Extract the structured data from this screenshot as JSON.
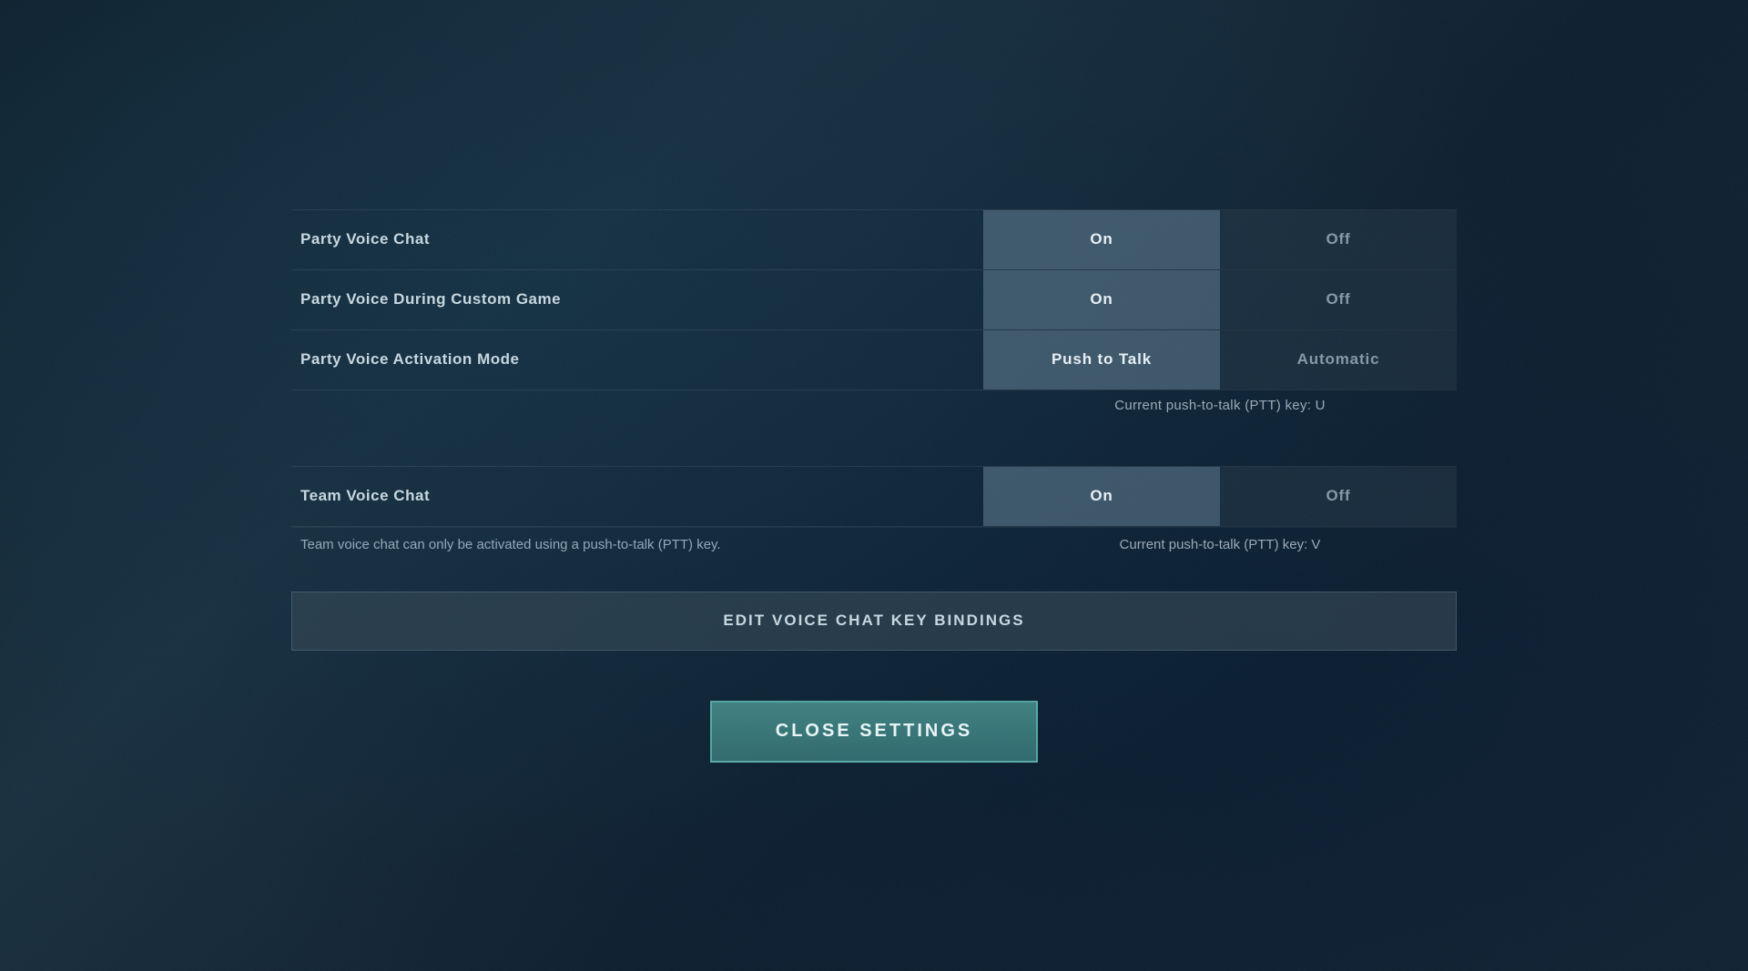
{
  "settings": {
    "party_voice_chat": {
      "label": "Party Voice Chat",
      "options": [
        "On",
        "Off"
      ],
      "selected": "On"
    },
    "party_voice_during_custom": {
      "label": "Party Voice During Custom Game",
      "options": [
        "On",
        "Off"
      ],
      "selected": "On"
    },
    "party_voice_activation": {
      "label": "Party Voice Activation Mode",
      "options": [
        "Push to Talk",
        "Automatic"
      ],
      "selected": "Push to Talk"
    },
    "party_ptt_key": {
      "label": "Current push-to-talk (PTT) key: U"
    },
    "team_voice_chat": {
      "label": "Team Voice Chat",
      "options": [
        "On",
        "Off"
      ],
      "selected": "On"
    },
    "team_voice_note": {
      "text": "Team voice chat can only be activated using a push-to-talk (PTT) key."
    },
    "team_ptt_key": {
      "label": "Current push-to-talk (PTT) key: V"
    }
  },
  "buttons": {
    "edit_bindings": "EDIT VOICE CHAT KEY BINDINGS",
    "close_settings": "CLOSE SETTINGS"
  }
}
